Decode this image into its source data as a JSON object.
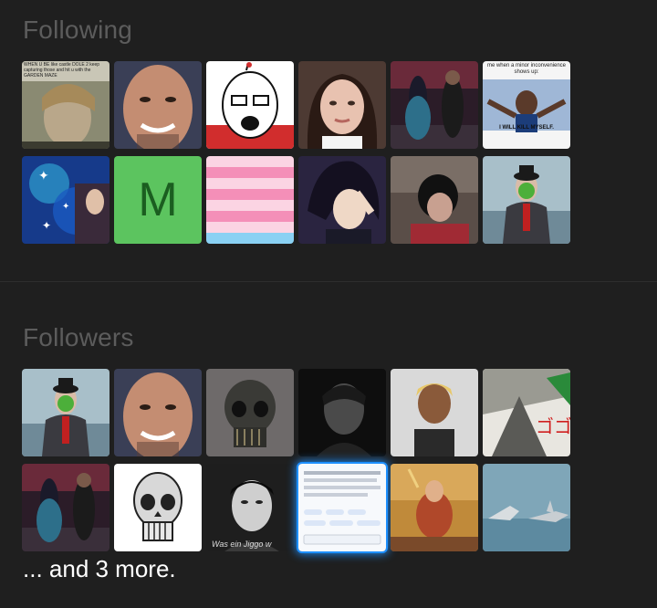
{
  "following": {
    "title": "Following",
    "tiles": [
      {
        "name": "avatar-game-character",
        "text": "WHEN U BE like castle DOLE 2 keep capturing those and hit u with the GARDEN MAZE"
      },
      {
        "name": "avatar-bald-man"
      },
      {
        "name": "avatar-cartoon-face"
      },
      {
        "name": "avatar-girl-portrait"
      },
      {
        "name": "avatar-dance-scene"
      },
      {
        "name": "avatar-meme-man",
        "top": "me when a minor inconvenience shows up:",
        "bottom": "I WILL KILL MYSELF."
      },
      {
        "name": "avatar-blue-sparkles"
      },
      {
        "name": "avatar-letter-m",
        "letter": "M"
      },
      {
        "name": "avatar-pastel-flag"
      },
      {
        "name": "avatar-anime-character"
      },
      {
        "name": "avatar-dark-hair-person"
      },
      {
        "name": "avatar-apple-man"
      }
    ]
  },
  "followers": {
    "title": "Followers",
    "tiles": [
      {
        "name": "avatar-apple-man"
      },
      {
        "name": "avatar-bald-man"
      },
      {
        "name": "avatar-metal-skull"
      },
      {
        "name": "avatar-dark-portrait"
      },
      {
        "name": "avatar-blonde-person"
      },
      {
        "name": "avatar-manga-panel"
      },
      {
        "name": "avatar-dance-scene"
      },
      {
        "name": "avatar-skull-drawing"
      },
      {
        "name": "avatar-bw-portrait",
        "caption": "Was ein Jiggo w"
      },
      {
        "name": "avatar-screenshot",
        "selected": true
      },
      {
        "name": "avatar-painting"
      },
      {
        "name": "avatar-sharks"
      }
    ],
    "more_text": "... and 3 more."
  }
}
